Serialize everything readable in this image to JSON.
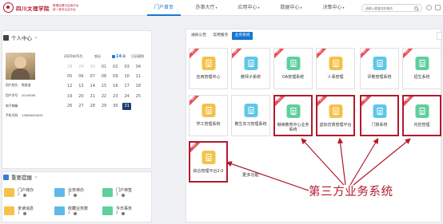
{
  "header": {
    "logo_name": "四川文理学院",
    "logo_sub": [
      "数据治理与应用平台",
      "统一身份认证平台"
    ],
    "nav": [
      {
        "label": "门户首页",
        "active": true,
        "dropdown": false
      },
      {
        "label": "办事大厅",
        "active": false,
        "dropdown": true
      },
      {
        "label": "应用中心",
        "active": false,
        "dropdown": true
      },
      {
        "label": "数据中心",
        "active": false,
        "dropdown": true
      },
      {
        "label": "决策中心",
        "active": false,
        "dropdown": true
      }
    ],
    "search_placeholder": "请输入要查找的服务"
  },
  "personal": {
    "title": "个人中心",
    "info": [
      {
        "label": "用户姓名",
        "value": "陈俊波"
      },
      {
        "label": "用户学号",
        "value": "2019536"
      },
      {
        "label": "电子邮箱",
        "value": ""
      },
      {
        "label": "手机号码",
        "value": "13064001870"
      }
    ],
    "calendar": {
      "month": "2025年05月",
      "lunar": "农历",
      "current_label": "14",
      "week_label": "周",
      "extra": "日历规则",
      "days": [
        {
          "d": "28",
          "muted": true
        },
        {
          "d": "29",
          "muted": true
        },
        {
          "d": "30",
          "muted": true
        },
        {
          "d": "01"
        },
        {
          "d": "02"
        },
        {
          "d": "03"
        },
        {
          "d": "04"
        },
        {
          "d": "05"
        },
        {
          "d": "06"
        },
        {
          "d": "07"
        },
        {
          "d": "08"
        },
        {
          "d": "09"
        },
        {
          "d": "10"
        },
        {
          "d": "11"
        },
        {
          "d": "12"
        },
        {
          "d": "13"
        },
        {
          "d": "14"
        },
        {
          "d": "15"
        },
        {
          "d": "16"
        },
        {
          "d": "17"
        },
        {
          "d": "18"
        },
        {
          "d": "19"
        },
        {
          "d": "20"
        },
        {
          "d": "21"
        },
        {
          "d": "22"
        },
        {
          "d": "23"
        },
        {
          "d": "24"
        },
        {
          "d": "25"
        },
        {
          "d": "26"
        },
        {
          "d": "27"
        },
        {
          "d": "28"
        },
        {
          "d": "29"
        },
        {
          "d": "30"
        },
        {
          "d": "31",
          "today": true
        }
      ]
    }
  },
  "reminders": {
    "title": "重要提醒",
    "items": [
      {
        "label": "门户待办",
        "count": "2",
        "color": "#f5c24a"
      },
      {
        "label": "业务待办",
        "count": "2",
        "color": "#5fb8e8"
      },
      {
        "label": "门户待签",
        "count": "2",
        "color": "#5fcf9c"
      },
      {
        "label": "未读消息",
        "count": "2",
        "color": "#f5c24a"
      },
      {
        "label": "收藏业务数",
        "count": "2",
        "color": "#5fb8e8"
      },
      {
        "label": "今日事务",
        "count": "2",
        "color": "#5fcf9c"
      }
    ]
  },
  "tabs": [
    {
      "label": "通知公告",
      "active": false
    },
    {
      "label": "常用服务",
      "active": false
    },
    {
      "label": "业务系统",
      "active": true
    }
  ],
  "tiles": [
    {
      "label": "应用管理中心",
      "color": "#f5c24a",
      "ribbon": "NEW",
      "hl": false
    },
    {
      "label": "教师子系统",
      "color": "#5fc7e8",
      "ribbon": "NEW",
      "hl": false
    },
    {
      "label": "OA管理系统",
      "color": "#5fcf9c",
      "ribbon": "NEW",
      "hl": false
    },
    {
      "label": "人事管理",
      "color": "#f5c24a",
      "ribbon": "NEW",
      "hl": false
    },
    {
      "label": "评教管理系统",
      "color": "#5fc7e8",
      "ribbon": "NEW",
      "hl": false
    },
    {
      "label": "招生系统",
      "color": "#5fcf9c",
      "ribbon": "NEW",
      "hl": false
    },
    {
      "label": "学工管理系统",
      "color": "#f5c24a",
      "ribbon": "NEW",
      "hl": false
    },
    {
      "label": "教生实习管理系统",
      "color": "#5fc7e8",
      "ribbon": "",
      "hl": false
    },
    {
      "label": "继续教育中心业务系统",
      "color": "#5fcf9c",
      "ribbon": "NEW",
      "hl": true
    },
    {
      "label": "虚拟仿真管理平台",
      "color": "#f5c24a",
      "ribbon": "NEW",
      "hl": true
    },
    {
      "label": "门禁系统",
      "color": "#5fc7e8",
      "ribbon": "NEW",
      "hl": true
    },
    {
      "label": "内控管理",
      "color": "#5fcf9c",
      "ribbon": "NEW",
      "hl": true
    },
    {
      "label": "综合管理平台2.0",
      "color": "#f5c24a",
      "ribbon": "NEW",
      "hl": true
    }
  ],
  "more_label": "更多功能",
  "annotation": "第三方业务系统",
  "colors": {
    "accent": "#1677d2",
    "highlight": "#b3192e",
    "today": "#1b3f6e"
  }
}
